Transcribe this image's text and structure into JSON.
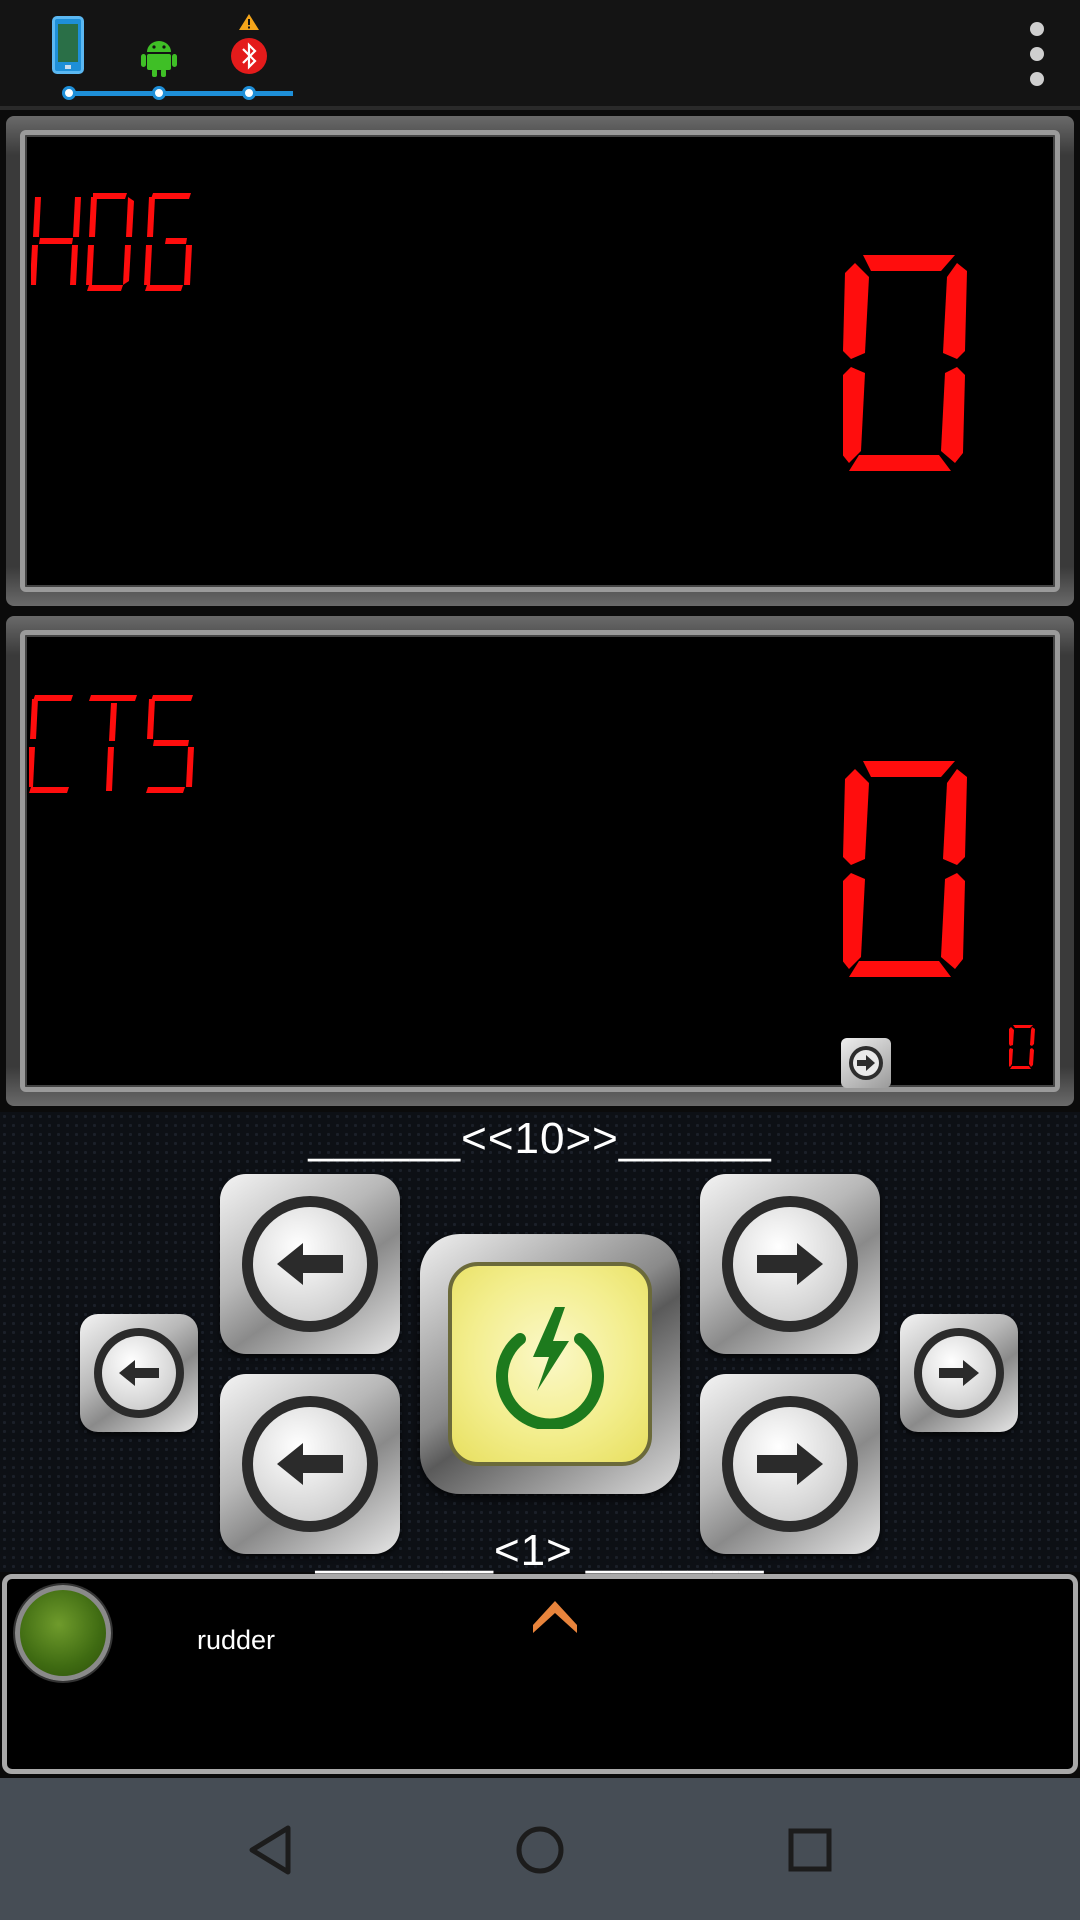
{
  "status_bar": {
    "icons": [
      "phone-icon",
      "android-icon",
      "bluetooth-warning-icon"
    ],
    "menu_icon": "overflow-menu-icon",
    "connection_color": "#1e8fd8"
  },
  "heading_display": {
    "label": "HDG",
    "value": "0"
  },
  "course_display": {
    "label": "CTS",
    "value": "0",
    "sub_value": "0",
    "sub_button_icon": "arrow-right-circle-icon"
  },
  "controls": {
    "step_large_label": "______<<10>>______",
    "step_small_label": "_______<1>  _______",
    "buttons": {
      "left_10": "arrow-left-icon",
      "left_1": "arrow-left-icon",
      "left_small": "arrow-left-icon",
      "right_10": "arrow-right-icon",
      "right_1": "arrow-right-icon",
      "right_small": "arrow-right-icon",
      "power": "power-bolt-icon"
    },
    "power_color": "#f3ee8e"
  },
  "status_row": {
    "text": "rudder",
    "led_color": "#4a7a18",
    "chevron_color": "#e8843c"
  },
  "nav_bar": {
    "back": "back-icon",
    "home": "home-icon",
    "recents": "recents-icon"
  },
  "lcd_color": "#ff0d0d"
}
